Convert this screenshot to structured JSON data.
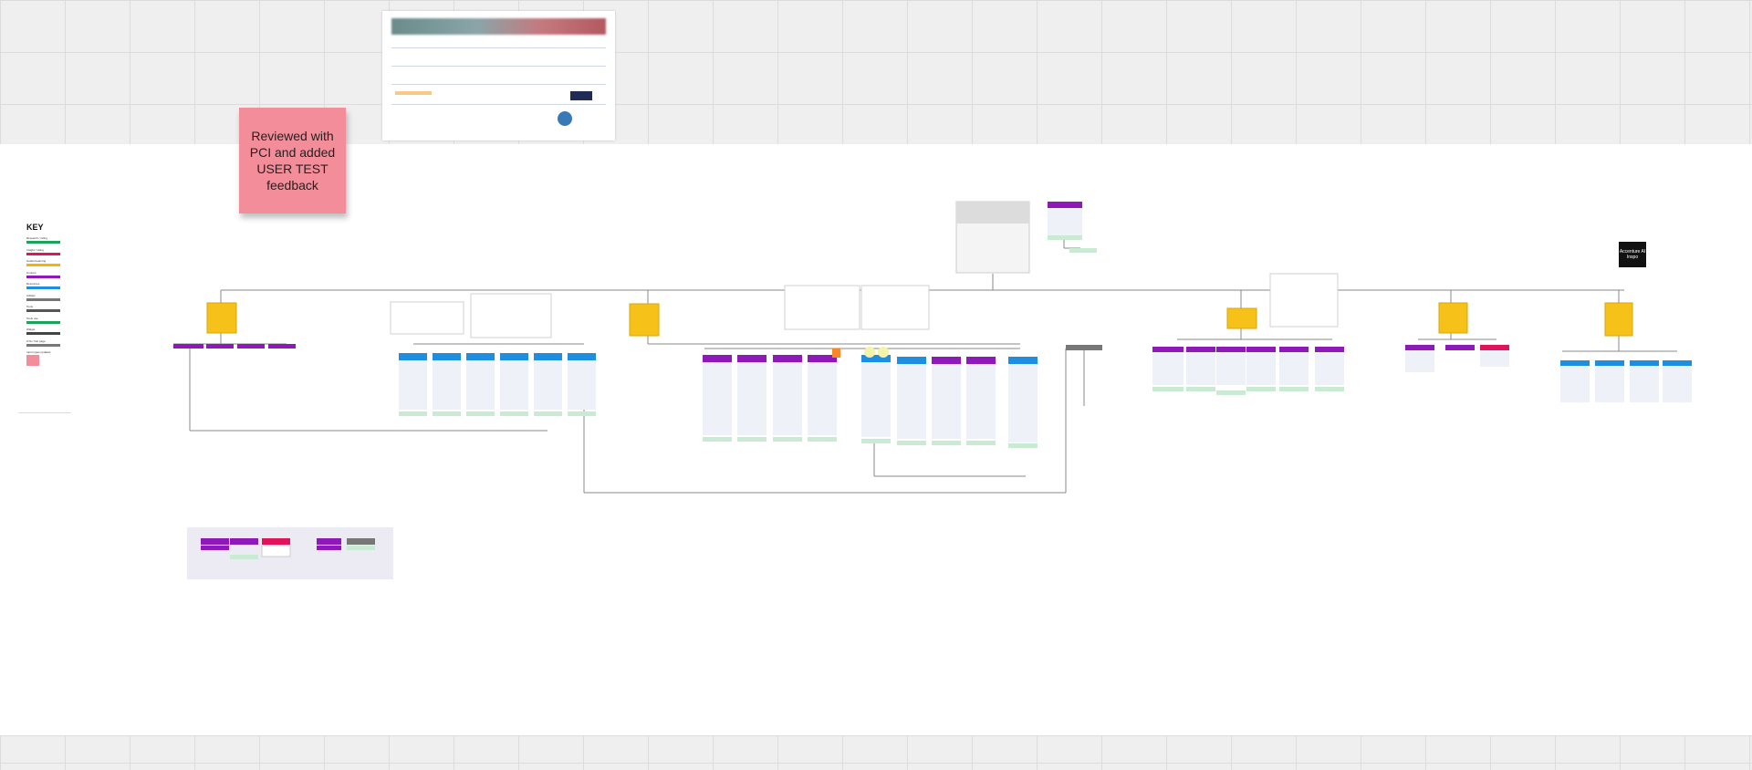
{
  "sticky_note": {
    "text": "Reviewed with PCI and added USER TEST feedback"
  },
  "key": {
    "title": "KEY",
    "items": [
      {
        "label": "Research / rating",
        "color": "#1aa35a"
      },
      {
        "label": "Insight / rating",
        "color": "#e0135b"
      },
      {
        "label": "Guided learning",
        "color": "#f4b300"
      },
      {
        "label": "Content",
        "color": "#8e19b8"
      },
      {
        "label": "Resources",
        "color": "#1e8fe0"
      },
      {
        "label": "Utilities",
        "color": "#777777"
      },
      {
        "label": "Tools",
        "color": "#555555"
      },
      {
        "label": "Tools use",
        "color": "#1aa35a"
      },
      {
        "label": "Widget",
        "color": "#444444"
      },
      {
        "label": "CTA / Info page",
        "color": "#777777"
      },
      {
        "label": "Input types updated",
        "color": "#f28d99"
      }
    ]
  },
  "dark_note": {
    "text": "Accenture AI Inspo"
  },
  "colors": {
    "purple": "#8e19b8",
    "blue": "#1e8fe0",
    "pink": "#e0135b",
    "yellow": "#f6c21a",
    "green_tag": "#c9ebd4",
    "grey": "#777777",
    "sticky": "#f28d99"
  }
}
